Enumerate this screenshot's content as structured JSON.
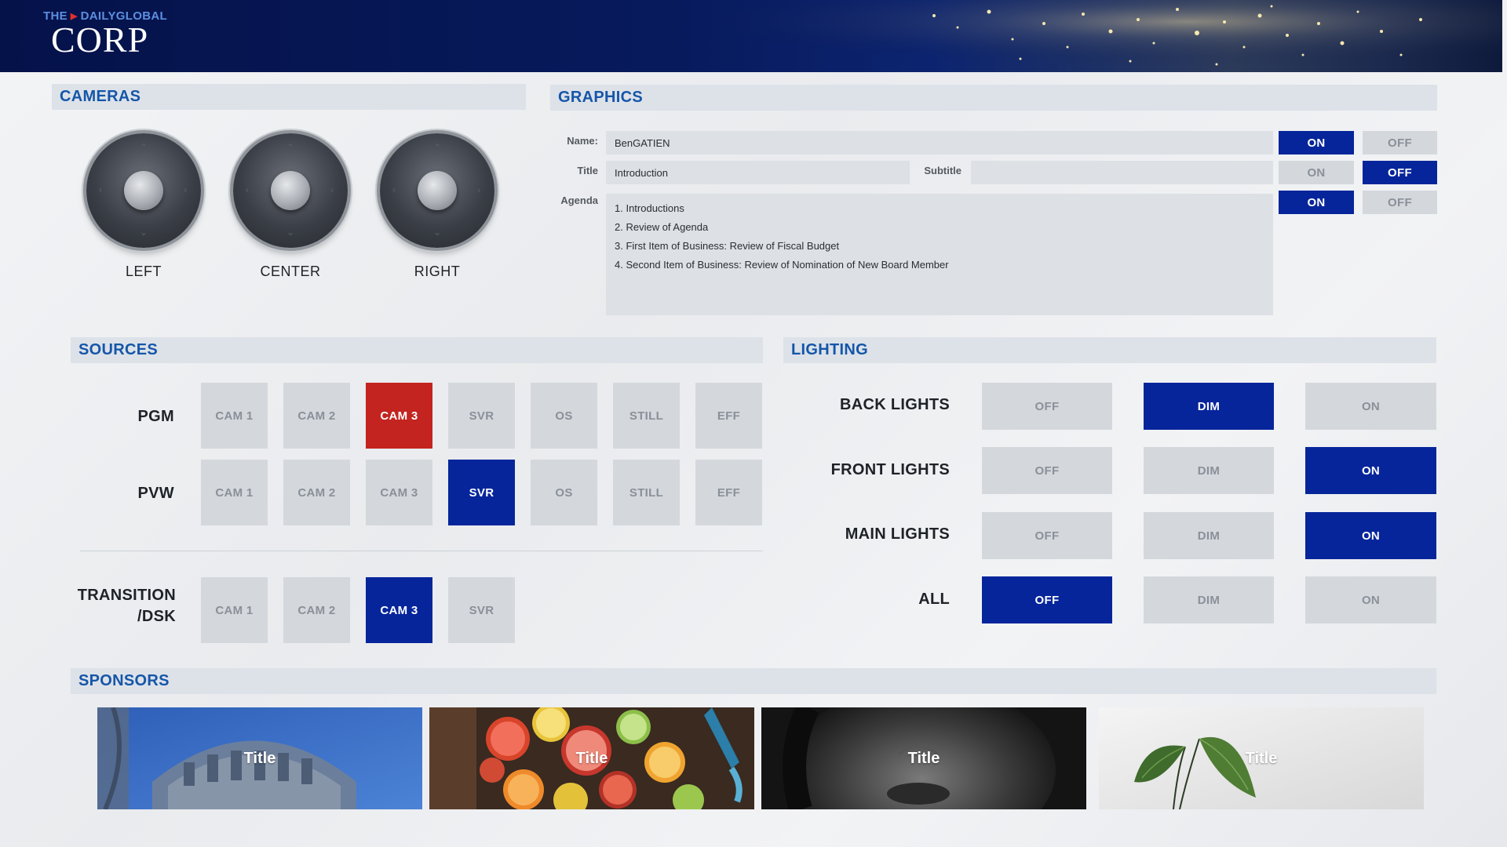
{
  "brand": {
    "top": "THE",
    "top_name": "DAILYGLOBAL",
    "main": "CORP"
  },
  "cameras": {
    "title": "CAMERAS",
    "joysticks": [
      {
        "label": "LEFT"
      },
      {
        "label": "CENTER"
      },
      {
        "label": "RIGHT"
      }
    ]
  },
  "graphics": {
    "title": "GRAPHICS",
    "name_label": "Name:",
    "name_value": "BenGATIEN",
    "title_label": "Title",
    "title_value": "Introduction",
    "subtitle_label": "Subtitle",
    "subtitle_value": "",
    "agenda_label": "Agenda",
    "agenda_items": [
      "1. Introductions",
      "2. Review of Agenda",
      "3. First Item of Business: Review of Fiscal Budget",
      "4. Second Item of Business: Review of Nomination of New Board Member"
    ],
    "toggles": [
      {
        "on": "ON",
        "off": "OFF",
        "state": "on"
      },
      {
        "on": "ON",
        "off": "OFF",
        "state": "off"
      },
      {
        "on": "ON",
        "off": "OFF",
        "state": "on"
      }
    ]
  },
  "sources": {
    "title": "SOURCES",
    "pgm_label": "PGM",
    "pvw_label": "PVW",
    "transition_label_1": "TRANSITION",
    "transition_label_2": "/DSK",
    "pgm": [
      "CAM 1",
      "CAM 2",
      "CAM 3",
      "SVR",
      "OS",
      "STILL",
      "EFF"
    ],
    "pgm_active": "CAM 3",
    "pvw": [
      "CAM 1",
      "CAM 2",
      "CAM 3",
      "SVR",
      "OS",
      "STILL",
      "EFF"
    ],
    "pvw_active": "SVR",
    "transition": [
      "CAM 1",
      "CAM 2",
      "CAM 3",
      "SVR"
    ],
    "transition_active": "CAM 3"
  },
  "lighting": {
    "title": "LIGHTING",
    "rows": [
      {
        "label": "BACK LIGHTS",
        "off": "OFF",
        "dim": "DIM",
        "on": "ON",
        "state": "dim"
      },
      {
        "label": "FRONT LIGHTS",
        "off": "OFF",
        "dim": "DIM",
        "on": "ON",
        "state": "on"
      },
      {
        "label": "MAIN LIGHTS",
        "off": "OFF",
        "dim": "DIM",
        "on": "ON",
        "state": "on"
      },
      {
        "label": "ALL",
        "off": "OFF",
        "dim": "DIM",
        "on": "ON",
        "state": "off"
      }
    ]
  },
  "sponsors": {
    "title": "SPONSORS",
    "cards": [
      {
        "title": "Title",
        "image": "dome-photo"
      },
      {
        "title": "Title",
        "image": "citrus-photo"
      },
      {
        "title": "Title",
        "image": "face-photo"
      },
      {
        "title": "Title",
        "image": "leaf-photo"
      }
    ]
  },
  "colors": {
    "active_blue": "#06259b",
    "active_red": "#c3241f",
    "inactive": "#d4d8dd",
    "section_header": "#dde2e9",
    "accent_text": "#1556a8"
  }
}
